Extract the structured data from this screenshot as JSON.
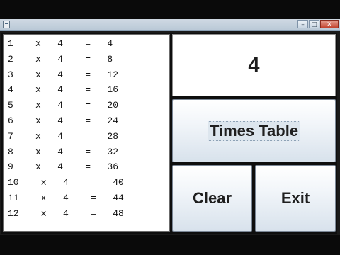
{
  "window": {
    "controls": {
      "minimize": "–",
      "maximize": "□",
      "close": "✕"
    }
  },
  "table": {
    "lines": [
      "1    x   4    =   4",
      "2    x   4    =   8",
      "3    x   4    =   12",
      "4    x   4    =   16",
      "5    x   4    =   20",
      "6    x   4    =   24",
      "7    x   4    =   28",
      "8    x   4    =   32",
      "9    x   4    =   36",
      "10    x   4    =   40",
      "11    x   4    =   44",
      "12    x   4    =   48"
    ]
  },
  "display": {
    "value": "4"
  },
  "buttons": {
    "times_table": "Times Table",
    "clear": "Clear",
    "exit": "Exit"
  },
  "icons": {
    "app": "java-app-icon"
  },
  "colors": {
    "frame": "#1a1a1a",
    "button_gradient_top": "#ffffff",
    "button_gradient_bottom": "#d8e2ec",
    "titlebar": "#cfd9e3",
    "close_button": "#c2432e"
  }
}
